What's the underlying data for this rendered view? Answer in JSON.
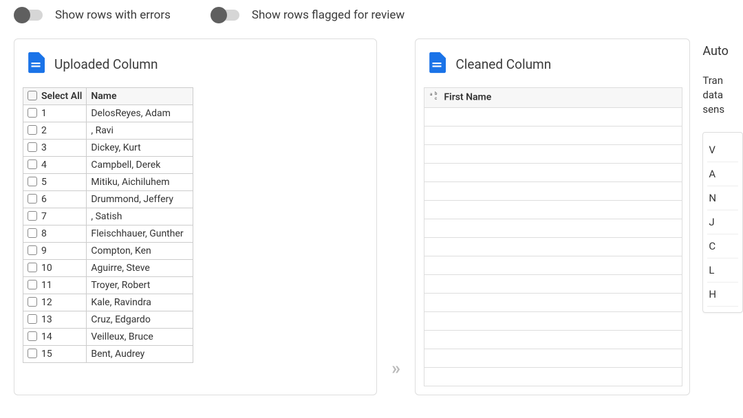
{
  "toggles": {
    "errors": "Show rows with errors",
    "flagged": "Show rows flagged for review"
  },
  "uploaded": {
    "title": "Uploaded Column",
    "selectAll": "Select All",
    "nameHeader": "Name",
    "rows": [
      {
        "idx": "1",
        "name": "DelosReyes, Adam"
      },
      {
        "idx": "2",
        "name": ", Ravi"
      },
      {
        "idx": "3",
        "name": "Dickey, Kurt"
      },
      {
        "idx": "4",
        "name": "Campbell, Derek"
      },
      {
        "idx": "5",
        "name": "Mitiku, Aichiluhem"
      },
      {
        "idx": "6",
        "name": "Drummond, Jeffery"
      },
      {
        "idx": "7",
        "name": ", Satish"
      },
      {
        "idx": "8",
        "name": "Fleischhauer, Gunther"
      },
      {
        "idx": "9",
        "name": "Compton, Ken"
      },
      {
        "idx": "10",
        "name": "Aguirre, Steve"
      },
      {
        "idx": "11",
        "name": "Troyer, Robert"
      },
      {
        "idx": "12",
        "name": "Kale, Ravindra"
      },
      {
        "idx": "13",
        "name": "Cruz, Edgardo"
      },
      {
        "idx": "14",
        "name": "Veilleux, Bruce"
      },
      {
        "idx": "15",
        "name": "Bent, Audrey"
      }
    ]
  },
  "cleaned": {
    "title": "Cleaned Column",
    "header": "First Name",
    "emptyRows": 15
  },
  "side": {
    "title": "Auto",
    "lines": [
      "Tran",
      "data",
      "sens"
    ],
    "rows": [
      "V",
      "A",
      "N",
      "J",
      "C",
      "L",
      "H"
    ]
  }
}
